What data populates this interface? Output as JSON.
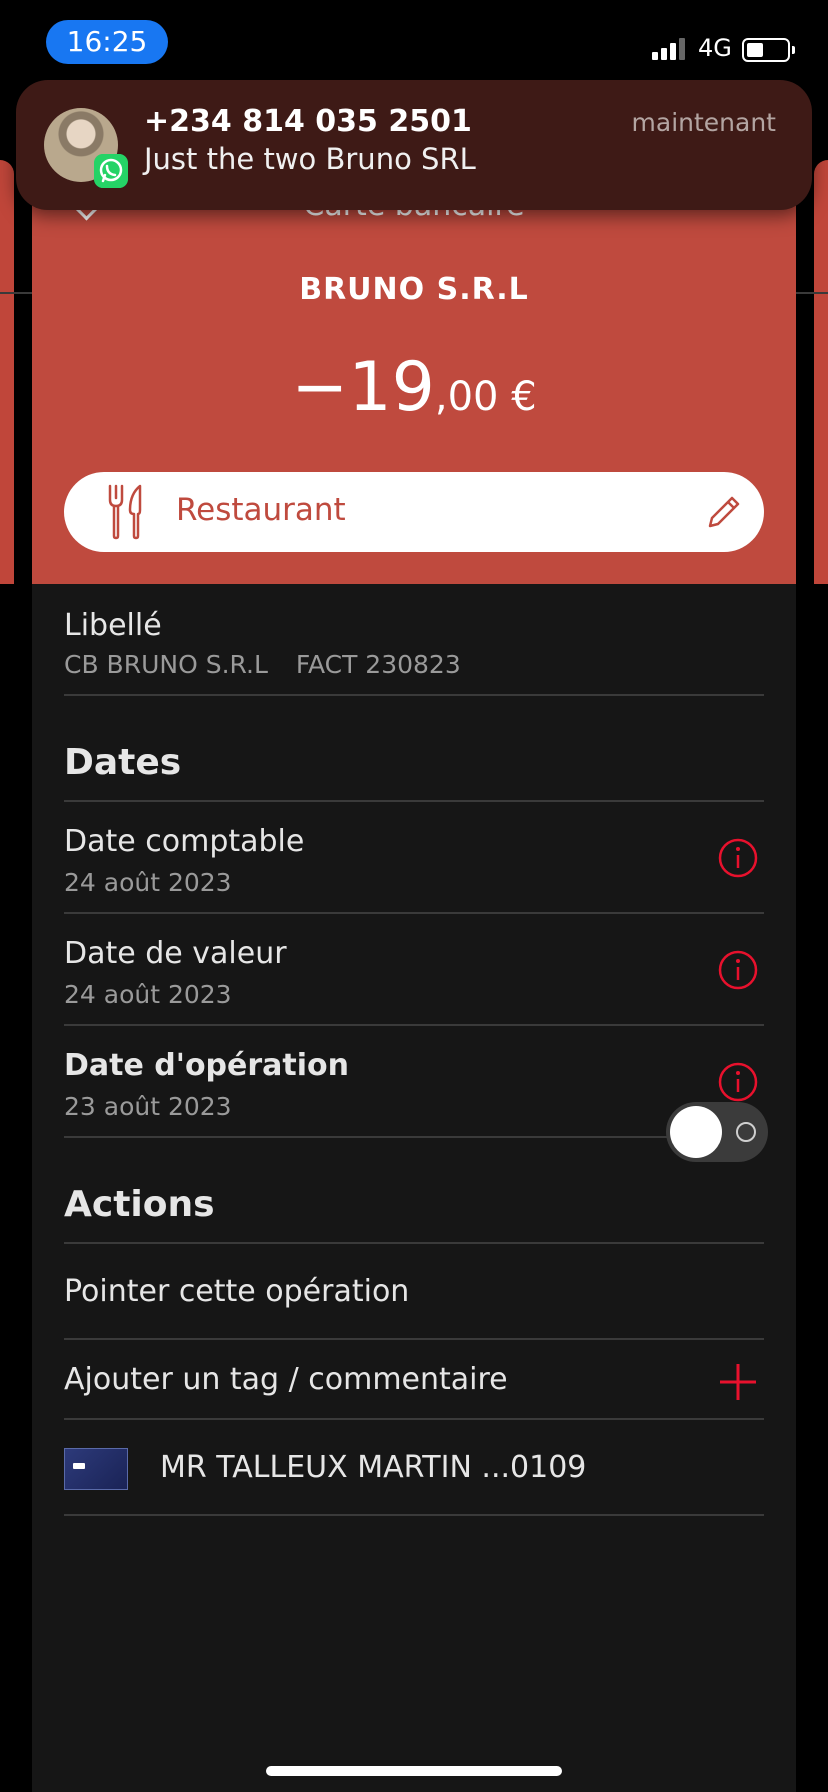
{
  "status_bar": {
    "time": "16:25",
    "network": "4G"
  },
  "notification": {
    "app": "WhatsApp",
    "title": "+234 814 035 2501",
    "message": "Just the two Bruno SRL",
    "time": "maintenant"
  },
  "header": {
    "title": "Carte bancaire",
    "merchant": "BRUNO S.R.L",
    "amount_main": "−19",
    "amount_cents": ",00 €",
    "category": "Restaurant",
    "accent_color": "#bf4a3e"
  },
  "libelle": {
    "label": "Libellé",
    "parts": [
      "CB BRUNO S.R.L",
      "FACT 230823"
    ]
  },
  "dates": {
    "title": "Dates",
    "items": [
      {
        "label": "Date comptable",
        "value": "24 août 2023"
      },
      {
        "label": "Date de valeur",
        "value": "24 août 2023"
      },
      {
        "label": "Date d'opération",
        "value": "23 août 2023"
      }
    ]
  },
  "actions": {
    "title": "Actions",
    "pointer_label": "Pointer cette opération",
    "pointer_enabled": false,
    "tag_label": "Ajouter un tag / commentaire",
    "card_label": "MR TALLEUX MARTIN ...0109"
  },
  "colors": {
    "info_red": "#e8112d",
    "card_bg": "#161616"
  }
}
